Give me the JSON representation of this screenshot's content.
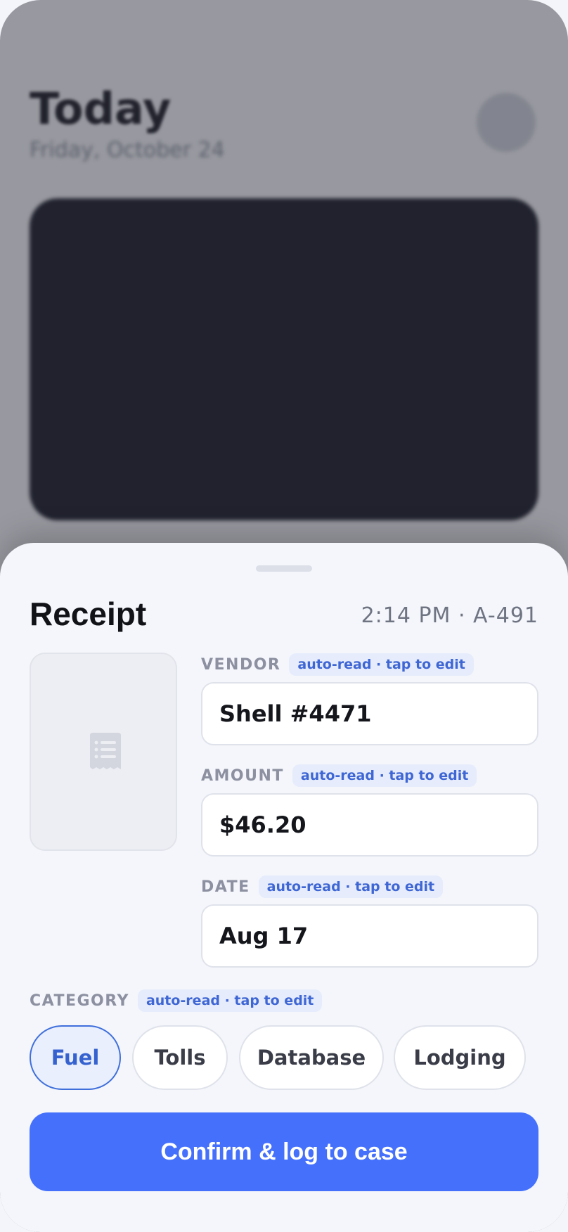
{
  "background": {
    "title": "Today",
    "subtitle": "Friday, October 24"
  },
  "sheet": {
    "title": "Receipt",
    "meta": "2:14 PM · A-491",
    "fields": [
      {
        "label": "VENDOR",
        "hint": "auto-read · tap to edit",
        "value": "Shell #4471"
      },
      {
        "label": "AMOUNT",
        "hint": "auto-read · tap to edit",
        "value": "$46.20"
      },
      {
        "label": "DATE",
        "hint": "auto-read · tap to edit",
        "value": "Aug 17"
      }
    ],
    "category": {
      "label": "CATEGORY",
      "hint": "auto-read · tap to edit",
      "options": [
        "Fuel",
        "Tolls",
        "Database",
        "Lodging"
      ],
      "selected": "Fuel"
    },
    "confirm_label": "Confirm & log to case"
  },
  "colors": {
    "accent": "#4470fb",
    "hint_text": "#3e66d4",
    "hint_bg": "#e6ecfb"
  },
  "icons": {
    "receipt_thumbnail": "receipt-icon"
  }
}
